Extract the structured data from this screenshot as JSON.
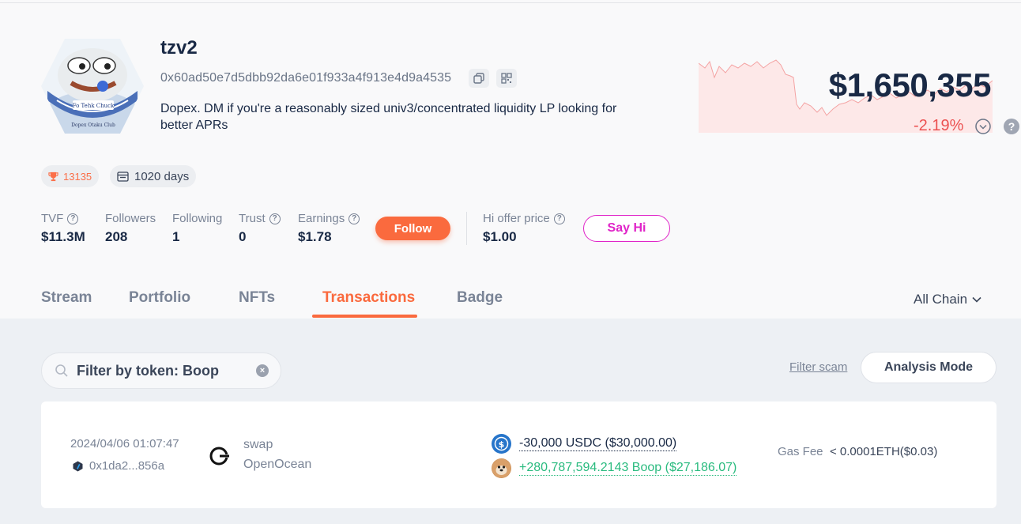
{
  "profile": {
    "name": "tzv2",
    "address": "0x60ad50e7d5dbb92da6e01f933a4f913e4d9a4535",
    "bio": "Dopex. DM if you're a reasonably sized univ3/concentrated liquidity LP looking for better APRs",
    "avatar_text_top": "Fo Tehk Chuck",
    "avatar_text_bottom": "Dopex Otaku Club"
  },
  "networth": {
    "value": "$1,650,355",
    "change": "-2.19%"
  },
  "badges": {
    "score": "13135",
    "days": "1020 days"
  },
  "stats": [
    {
      "label": "TVF",
      "value": "$11.3M"
    },
    {
      "label": "Followers",
      "value": "208"
    },
    {
      "label": "Following",
      "value": "1"
    },
    {
      "label": "Trust",
      "value": "0"
    },
    {
      "label": "Earnings",
      "value": "$1.78"
    }
  ],
  "follow_label": "Follow",
  "hi_offer": {
    "label": "Hi offer price",
    "value": "$1.00"
  },
  "say_hi_label": "Say Hi",
  "tabs": [
    "Stream",
    "Portfolio",
    "NFTs",
    "Transactions",
    "Badge"
  ],
  "active_tab": "Transactions",
  "chain_filter": "All Chain",
  "search": {
    "value": "Filter by token: Boop"
  },
  "filter_scam_label": "Filter scam",
  "analysis_mode_label": "Analysis Mode",
  "transactions": [
    {
      "time": "2024/04/06 01:07:47",
      "hash": "0x1da2...856a",
      "type": "swap",
      "protocol": "OpenOcean",
      "token_out": "-30,000 USDC ($30,000.00)",
      "token_in": "+280,787,594.2143 Boop ($27,186.07)",
      "gas_label": "Gas Fee",
      "gas_value": "< 0.0001ETH($0.03)"
    }
  ],
  "colors": {
    "accent": "#fa6a3e",
    "negative": "#ec5151",
    "positive": "#2abb7f",
    "say_hi": "#e024c8"
  }
}
